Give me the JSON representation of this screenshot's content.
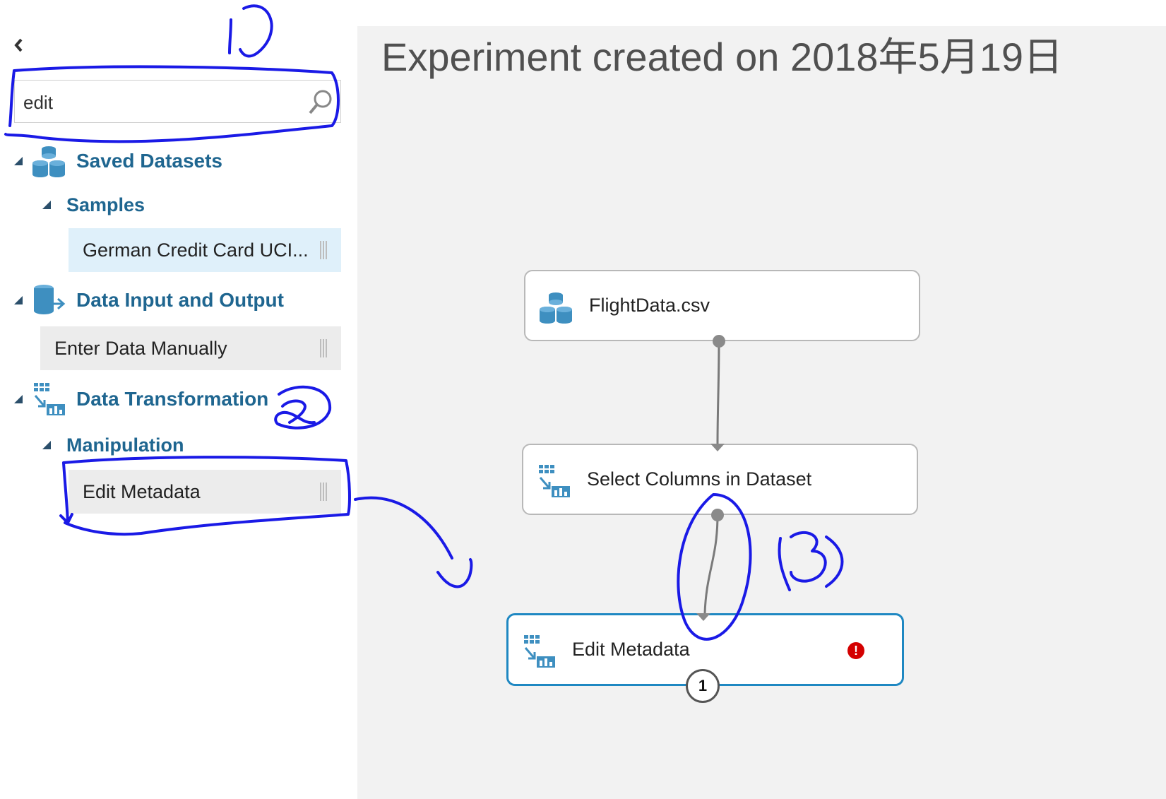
{
  "palette": {
    "search": {
      "value": "edit"
    },
    "categories": {
      "saved_datasets": {
        "label": "Saved Datasets"
      },
      "samples": {
        "label": "Samples"
      },
      "german_credit": {
        "label": "German Credit Card UCI..."
      },
      "data_io": {
        "label": "Data Input and Output"
      },
      "enter_data": {
        "label": "Enter Data Manually"
      },
      "data_transform": {
        "label": "Data Transformation"
      },
      "manipulation": {
        "label": "Manipulation"
      },
      "edit_metadata": {
        "label": "Edit Metadata"
      }
    }
  },
  "canvas": {
    "title": "Experiment created on 2018年5月19日",
    "nodes": {
      "flightdata": {
        "label": "FlightData.csv"
      },
      "select_columns": {
        "label": "Select Columns in Dataset"
      },
      "edit_metadata": {
        "label": "Edit Metadata",
        "badge": "1",
        "error": "!"
      }
    }
  },
  "annotations": {
    "marks": [
      "1",
      "2",
      "3"
    ]
  },
  "colors": {
    "accent": "#1f88c2",
    "category_text": "#1f6690",
    "selected_item_bg": "#dff0fa",
    "item_bg": "#ececec",
    "canvas_bg": "#f2f2f2",
    "annotation_pen": "#1a1ae6",
    "error": "#d40000"
  }
}
